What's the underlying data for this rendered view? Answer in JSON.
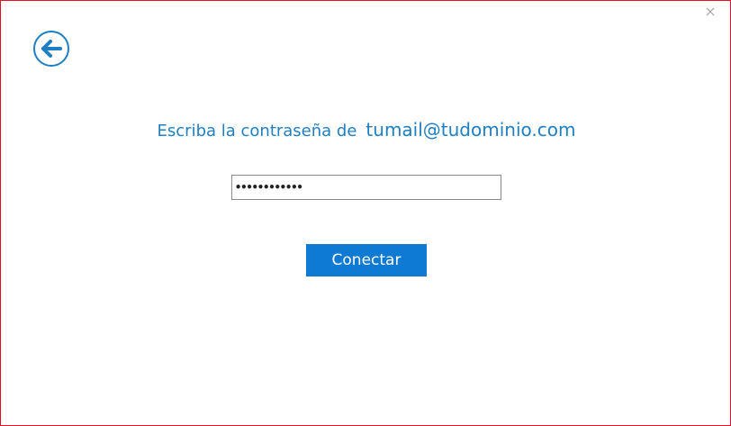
{
  "window": {
    "border_color": "#e81123",
    "close_icon": "close-icon"
  },
  "navigation": {
    "back_icon": "back-arrow-icon",
    "accent_color": "#1e7fc4"
  },
  "prompt": {
    "label": "Escriba la contraseña de",
    "email": "tumail@tudominio.com",
    "color": "#1e7fc4"
  },
  "password_field": {
    "value": "••••••••••••"
  },
  "connect_button": {
    "label": "Conectar",
    "color": "#0f7ad4"
  }
}
